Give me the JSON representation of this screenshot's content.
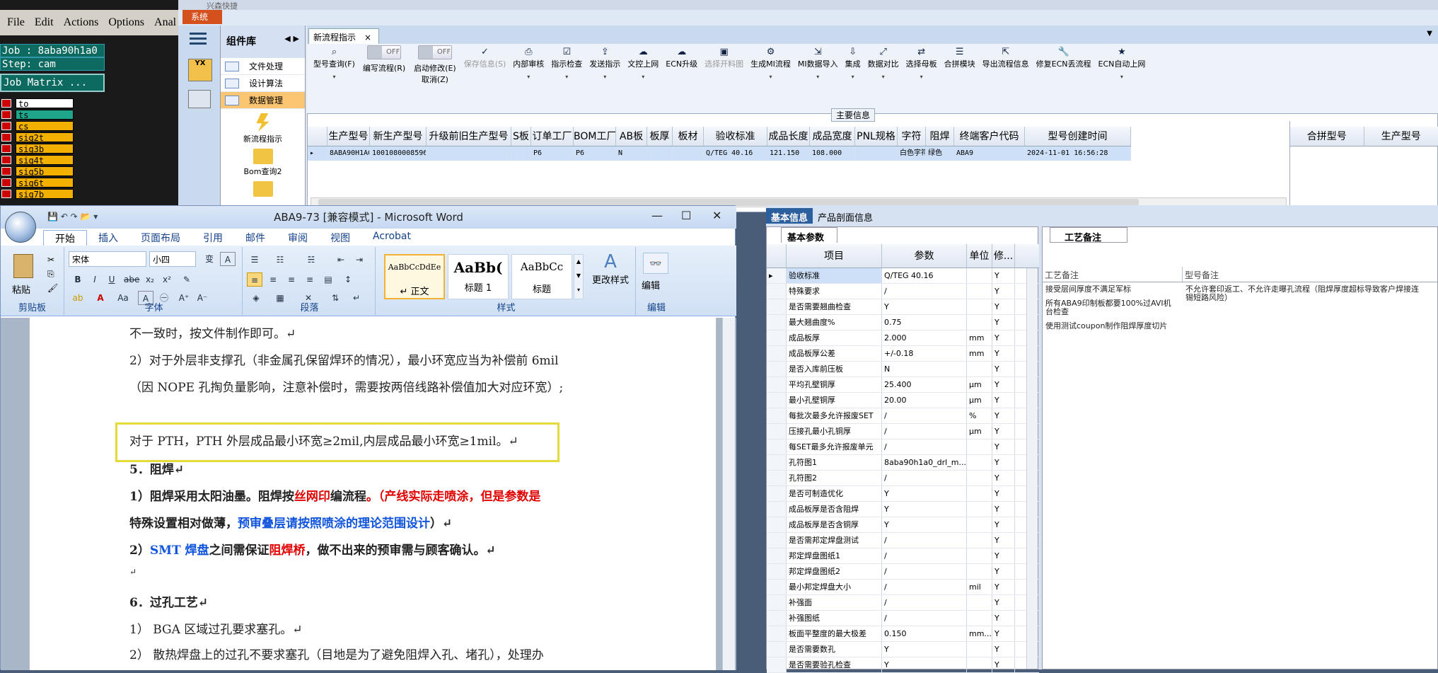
{
  "cam": {
    "menu": [
      "File",
      "Edit",
      "Actions",
      "Options",
      "Anal"
    ],
    "job": "Job : 8aba90h1a0",
    "step": "Step: cam",
    "job_matrix": "Job Matrix ...",
    "layers": [
      "to",
      "ts",
      "cs",
      "sig2t",
      "sig3b",
      "sig4t",
      "sig5b",
      "sig6t",
      "sig7b"
    ]
  },
  "mes": {
    "title_partial": "兴森快捷",
    "sys_btn": "系统",
    "component_lib": "组件库",
    "components": [
      "文件处理",
      "设计算法",
      "数据管理"
    ],
    "launchers": [
      "新流程指示",
      "Bom查询2"
    ],
    "tab": "新流程指示",
    "toolbar": [
      {
        "icon": "search-icon",
        "label": "型号查询(F)",
        "sub": "▾"
      },
      {
        "toggle": true,
        "label": "编写流程(R)",
        "state": "OFF"
      },
      {
        "toggle": true,
        "label": "启动修改(E)",
        "label2": "取消(Z)",
        "state": "OFF"
      },
      {
        "icon": "check-icon",
        "label": "保存信息(S)",
        "disabled": true
      },
      {
        "icon": "print-icon",
        "label": "内部审核",
        "sub": "▾"
      },
      {
        "icon": "clipboard-check-icon",
        "label": "指示检查",
        "sub": "▾"
      },
      {
        "icon": "upload-icon",
        "label": "发送指示",
        "sub": "▾"
      },
      {
        "icon": "cloud-upload-icon",
        "label": "文控上网",
        "sub": "▾"
      },
      {
        "icon": "cloud-icon",
        "label": "ECN升级"
      },
      {
        "icon": "image-icon",
        "label": "选择开料图",
        "disabled": true
      },
      {
        "icon": "flow-icon",
        "label": "生成MI流程",
        "sub": "▾"
      },
      {
        "icon": "import-icon",
        "label": "MI数据导入",
        "sub": "▾"
      },
      {
        "icon": "download-icon",
        "label": "集成",
        "sub": "▾"
      },
      {
        "icon": "compare-icon",
        "label": "数据对比",
        "sub": "▾"
      },
      {
        "icon": "shuffle-icon",
        "label": "选择母板",
        "sub": "▾"
      },
      {
        "icon": "list-icon",
        "label": "合拼模块"
      },
      {
        "icon": "export-icon",
        "label": "导出流程信息"
      },
      {
        "icon": "wrench-icon",
        "label": "修复ECN丢流程"
      },
      {
        "icon": "star-icon",
        "label": "ECN自动上网",
        "sub": "▾"
      }
    ],
    "main_info_caption": "主要信息",
    "grid_headers": [
      "生产型号",
      "新生产型号",
      "升级前旧生产型号",
      "S板",
      "订单工厂",
      "BOM工厂",
      "AB板",
      "板厚",
      "板材",
      "验收标准",
      "成品长度",
      "成品宽度",
      "PNL规格",
      "字符",
      "阻焊",
      "终端客户代码",
      "型号创建时间"
    ],
    "grid_row": [
      "8ABA90H1A0",
      "10010800085966",
      "",
      "",
      "P6",
      "P6",
      "N",
      "",
      "",
      "Q/TEG 40.16",
      "121.150",
      "108.000",
      "",
      "白色字符",
      "绿色",
      "ABA9",
      "2024-11-01 16:56:28"
    ],
    "right_headers": [
      "合拼型号",
      "生产型号"
    ]
  },
  "detail": {
    "tabs": [
      "基本信息",
      "产品剖面信息"
    ],
    "param_tab": "基本参数",
    "param_headers": [
      "项目",
      "参数",
      "单位",
      "修..."
    ],
    "rows": [
      [
        "验收标准",
        "Q/TEG 40.16",
        "",
        "Y"
      ],
      [
        "特殊要求",
        "/",
        "",
        "Y"
      ],
      [
        "是否需要翘曲检查",
        "Y",
        "",
        "Y"
      ],
      [
        "最大翘曲度%",
        "0.75",
        "",
        "Y"
      ],
      [
        "成品板厚",
        "2.000",
        "mm",
        "Y"
      ],
      [
        "成品板厚公差",
        "+/-0.18",
        "mm",
        "Y"
      ],
      [
        "是否入库前压板",
        "N",
        "",
        "Y"
      ],
      [
        "平均孔壁铜厚",
        "25.400",
        "μm",
        "Y"
      ],
      [
        "最小孔壁铜厚",
        "20.00",
        "μm",
        "Y"
      ],
      [
        "每批次最多允许报废SET",
        "/",
        "%",
        "Y"
      ],
      [
        "压接孔最小孔铜厚",
        "/",
        "μm",
        "Y"
      ],
      [
        "每SET最多允许报废单元",
        "/",
        "",
        "Y"
      ],
      [
        "孔符图1",
        "8aba90h1a0_drl_m...",
        "",
        "Y"
      ],
      [
        "孔符图2",
        "/",
        "",
        "Y"
      ],
      [
        "是否可制造优化",
        "Y",
        "",
        "Y"
      ],
      [
        "成品板厚是否含阻焊",
        "Y",
        "",
        "Y"
      ],
      [
        "成品板厚是否含铜厚",
        "Y",
        "",
        "Y"
      ],
      [
        "是否需邦定焊盘测试",
        "/",
        "",
        "Y"
      ],
      [
        "邦定焊盘图纸1",
        "/",
        "",
        "Y"
      ],
      [
        "邦定焊盘图纸2",
        "/",
        "",
        "Y"
      ],
      [
        "最小邦定焊盘大小",
        "/",
        "mil",
        "Y"
      ],
      [
        "补强面",
        "/",
        "",
        "Y"
      ],
      [
        "补强图纸",
        "/",
        "",
        "Y"
      ],
      [
        "板面平整度的最大极差",
        "0.150",
        "mm...",
        "Y"
      ],
      [
        "是否需要数孔",
        "Y",
        "",
        "Y"
      ],
      [
        "是否需要验孔检查",
        "Y",
        "",
        "Y"
      ]
    ],
    "remark_tab": "工艺备注",
    "remark_headers": [
      "工艺备注",
      "型号备注"
    ],
    "remarks": [
      "接受层间厚度不满足军标",
      "所有ABA9印制板都要100%过AVI机台检查",
      "使用测试coupon制作阻焊厚度切片"
    ],
    "model_remark": "不允许套印返工、不允许走曝孔流程（阻焊厚度超标导致客户焊接连锡短路风险）"
  },
  "word": {
    "title": "ABA9-73 [兼容模式] - Microsoft Word",
    "tabs": [
      "开始",
      "插入",
      "页面布局",
      "引用",
      "邮件",
      "审阅",
      "视图",
      "Acrobat"
    ],
    "font_name": "宋体",
    "font_size": "小四",
    "groups": [
      "剪贴板",
      "字体",
      "段落",
      "样式",
      "编辑"
    ],
    "paste": "粘贴",
    "styles": [
      {
        "preview": "AaBbCcDdEe",
        "name": "↵ 正文"
      },
      {
        "preview": "AaBb(",
        "name": "标题 1"
      },
      {
        "preview": "AaBbCc",
        "name": "标题"
      }
    ],
    "change_style": "更改样式",
    "edit": "编辑",
    "lines": [
      "不一致时，按文件制作即可。↵",
      "2）对于外层非支撑孔（非金属孔保留焊环的情况），最小环宽应当为补偿前 6mil",
      "（因 NOPE 孔掏负量影响，注意补偿时，需要按两倍线路补偿值加大对应环宽）;",
      "对于 PTH，PTH 外层成品最小环宽≥2mil,内层成品最小环宽≥1mil。↵",
      "5．阻焊↵",
      "6．过孔工艺↵",
      "1） BGA 区域过孔要求塞孔。↵",
      "2） 散热焊盘上的过孔不要求塞孔（目地是为了避免阻焊入孔、堵孔），处理办"
    ],
    "sm1": [
      "1）阻焊采用太阳油墨。阻焊按",
      "丝网印",
      "编流程",
      "。（产线实际走喷涂，但是参数是"
    ],
    "sm2": [
      "特殊设置相对做薄，",
      "预审叠层请按照喷涂的理论范围设计",
      "）↵"
    ],
    "sm3": [
      "2）",
      "SMT 焊盘",
      "之间需保证",
      "阻焊桥",
      "，做不出来的预审需与顾客确认。↵"
    ],
    "empty_para": "↵"
  }
}
